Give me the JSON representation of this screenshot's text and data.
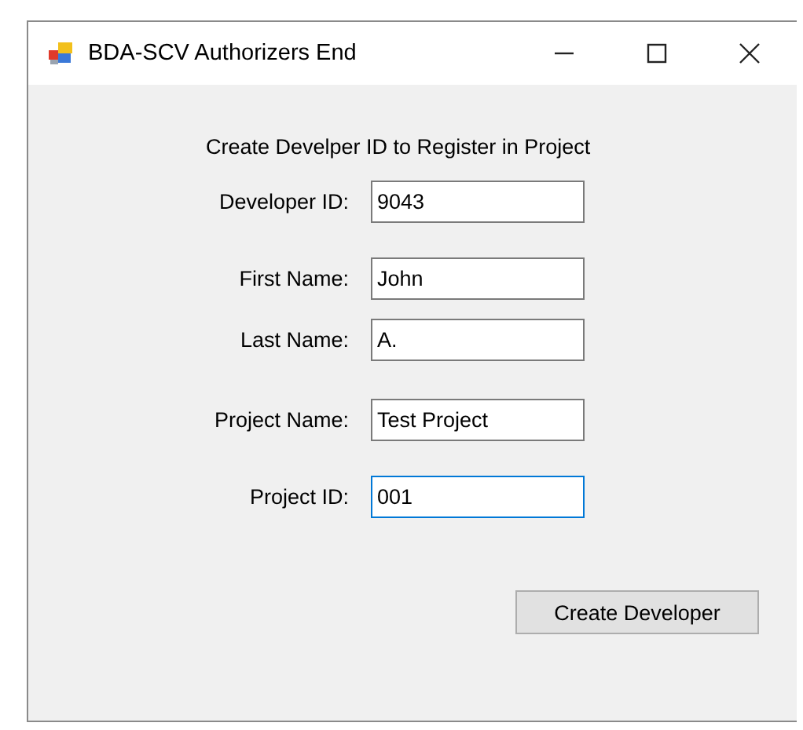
{
  "window": {
    "title": "BDA-SCV Authorizers End"
  },
  "heading": "Create Develper ID to Register in Project",
  "fields": [
    {
      "label": "Developer ID:",
      "value": "9043",
      "focused": false
    },
    {
      "label": "First Name:",
      "value": "John",
      "focused": false
    },
    {
      "label": "Last Name:",
      "value": "A.",
      "focused": false
    },
    {
      "label": "Project Name:",
      "value": "Test Project",
      "focused": false
    },
    {
      "label": "Project ID:",
      "value": "001",
      "focused": true
    }
  ],
  "button": "Create Developer"
}
